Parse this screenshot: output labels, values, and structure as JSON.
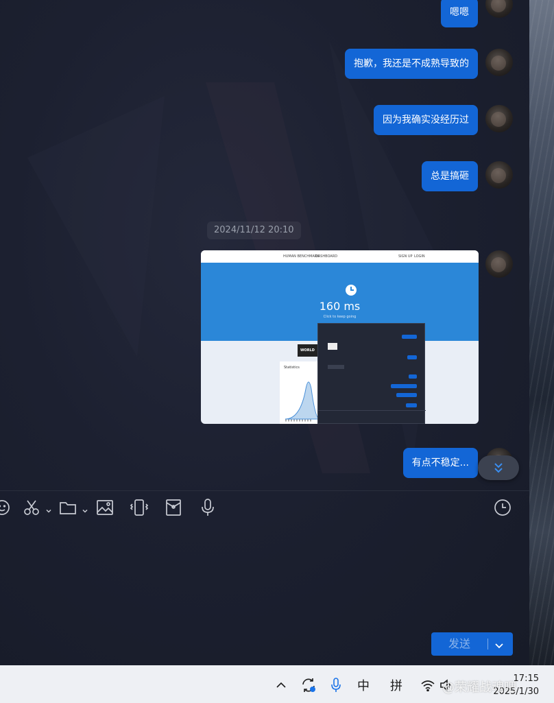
{
  "messages": [
    {
      "text": "嗯嗯"
    },
    {
      "text": "抱歉，我还是不成熟导致的"
    },
    {
      "text": "因为我确实没经历过"
    },
    {
      "text": "总是搞砸"
    },
    {
      "text": "有点不稳定..."
    }
  ],
  "timestamp": "2024/11/12 20:10",
  "image_message": {
    "nav_left": "HUMAN BENCHMARK",
    "nav_mid": "DASHBOARD",
    "nav_signup": "SIGN UP",
    "nav_login": "LOGIN",
    "result": "160 ms",
    "subtext": "Click to keep going",
    "thumb_label": "WORLD",
    "stats_label": "Statistics"
  },
  "send": {
    "label": "发送"
  },
  "taskbar": {
    "ime_chinese": "中",
    "ime_pinyin": "拼",
    "time": "17:15",
    "date": "2025/1/30"
  },
  "watermark": "@荣耀战魂吧",
  "colors": {
    "bubble": "#1366d6",
    "window_bg": "#1c2030",
    "taskbar_bg": "#eef0f4"
  }
}
